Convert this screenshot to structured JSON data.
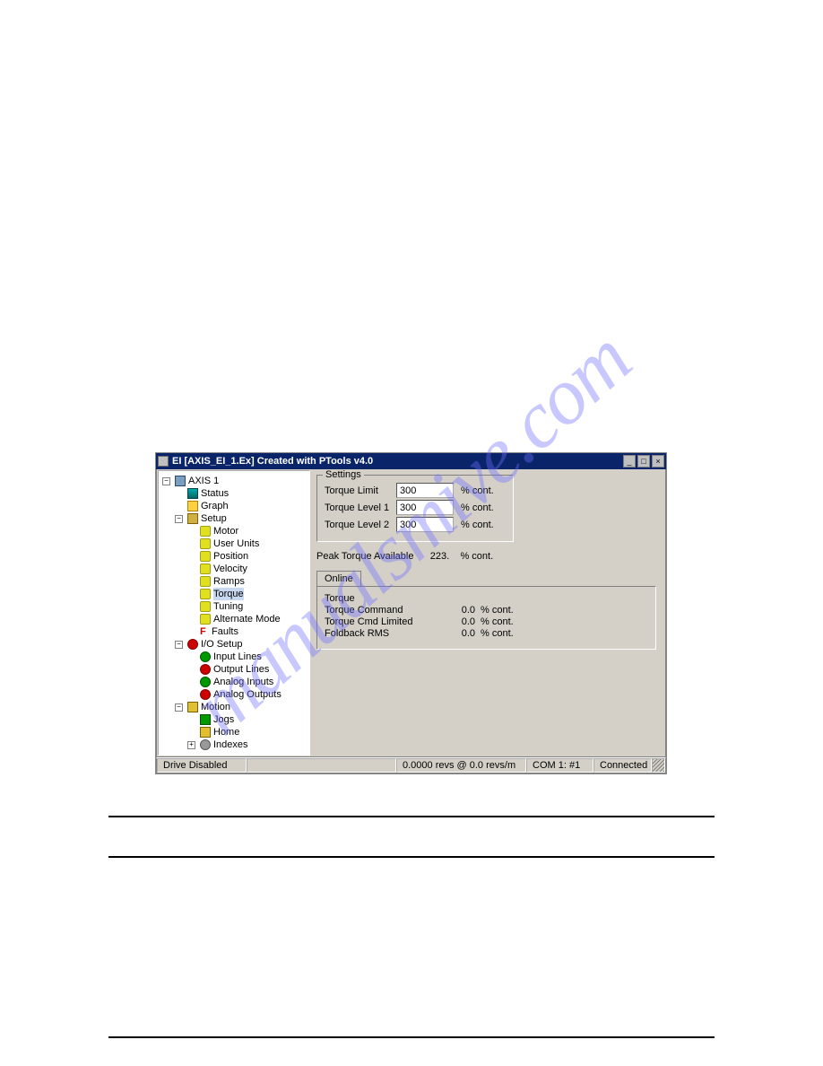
{
  "window": {
    "title": "EI  [AXIS_EI_1.Ex] Created with PTools v4.0",
    "min": "_",
    "max": "□",
    "close": "×"
  },
  "tree": {
    "root": "AXIS 1",
    "status": "Status",
    "graph": "Graph",
    "setup": {
      "label": "Setup",
      "items": [
        "Motor",
        "User Units",
        "Position",
        "Velocity",
        "Ramps",
        "Torque",
        "Tuning",
        "Alternate Mode",
        "Faults"
      ]
    },
    "io": {
      "label": "I/O Setup",
      "items": [
        "Input Lines",
        "Output Lines",
        "Analog Inputs",
        "Analog Outputs"
      ]
    },
    "motion": {
      "label": "Motion",
      "items": [
        "Jogs",
        "Home",
        "Indexes"
      ]
    }
  },
  "settings": {
    "caption": "Settings",
    "fields": {
      "limit": {
        "label": "Torque Limit",
        "value": "300",
        "unit": "% cont."
      },
      "level1": {
        "label": "Torque Level 1",
        "value": "300",
        "unit": "% cont."
      },
      "level2": {
        "label": "Torque Level 2",
        "value": "300",
        "unit": "% cont."
      }
    }
  },
  "peak": {
    "label": "Peak Torque Available",
    "value": "223.",
    "unit": "% cont."
  },
  "online": {
    "tab": "Online",
    "rows": {
      "torque": {
        "label": "Torque",
        "value": "",
        "unit": ""
      },
      "cmd": {
        "label": "Torque Command",
        "value": "0.0",
        "unit": "% cont."
      },
      "cmdlim": {
        "label": "Torque Cmd Limited",
        "value": "0.0",
        "unit": "% cont."
      },
      "foldback": {
        "label": "Foldback RMS",
        "value": "0.0",
        "unit": "% cont."
      }
    }
  },
  "statusbar": {
    "drive": "Drive Disabled",
    "pos": "0.0000 revs @ 0.0 revs/m",
    "com": "COM 1: #1",
    "conn": "Connected"
  },
  "watermark": "manualsmive.com"
}
